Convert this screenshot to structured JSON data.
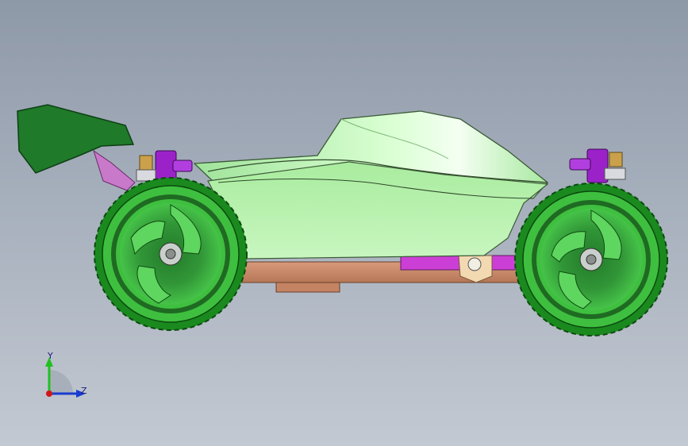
{
  "viewport": {
    "background_top": "#8e99a8",
    "background_bottom": "#c3c9d2"
  },
  "model": {
    "body_color": "#b8f2b0",
    "wing_color": "#1f7a2a",
    "wheel_color": "#39c83a",
    "tire_color": "#2fb52f",
    "chassis_color": "#c98a6a",
    "mount_color": "#9b22c8",
    "accent_color": "#e0358f"
  },
  "triad": {
    "y_label": "Y",
    "z_label": "Z",
    "y_color": "#20c020",
    "z_color": "#1a3bd0",
    "x_color": "#d01818"
  }
}
